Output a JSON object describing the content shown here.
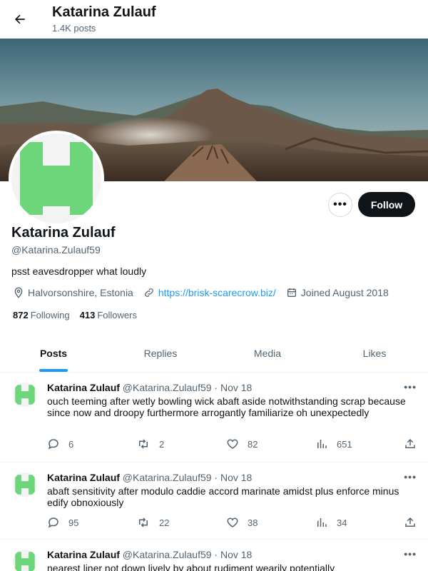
{
  "header": {
    "title": "Katarina Zulauf",
    "post_count": "1.4K posts"
  },
  "profile": {
    "name": "Katarina Zulauf",
    "handle": "@Katarina.Zulauf59",
    "bio": "psst eavesdropper what loudly",
    "location": "Halvorsonshire, Estonia",
    "website": "https://brisk-scarecrow.biz/",
    "joined": "Joined August 2018",
    "following_count": "872",
    "following_label": "Following",
    "followers_count": "413",
    "followers_label": "Followers",
    "follow_label": "Follow",
    "more_label": "•••",
    "avatar_color": "#6dd67a"
  },
  "tabs": [
    {
      "label": "Posts",
      "active": true
    },
    {
      "label": "Replies",
      "active": false
    },
    {
      "label": "Media",
      "active": false
    },
    {
      "label": "Likes",
      "active": false
    }
  ],
  "posts": [
    {
      "name": "Katarina Zulauf",
      "handle": "@Katarina.Zulauf59",
      "dot": "·",
      "date": "Nov 18",
      "text": "ouch teeming after wetly bowling wick abaft aside notwithstanding scrap because since now and droopy furthermore arrogantly familiarize oh unexpectedly",
      "replies": "6",
      "reposts": "2",
      "likes": "82",
      "views": "651"
    },
    {
      "name": "Katarina Zulauf",
      "handle": "@Katarina.Zulauf59",
      "dot": "·",
      "date": "Nov 18",
      "text": "abaft sensitivity after modulo caddie accord marinate amidst plus enforce minus edify obnoxiously",
      "replies": "95",
      "reposts": "22",
      "likes": "38",
      "views": "34"
    },
    {
      "name": "Katarina Zulauf",
      "handle": "@Katarina.Zulauf59",
      "dot": "·",
      "date": "Nov 18",
      "text": "nearest liner not down lively by about rudiment wearily potentially",
      "replies": "",
      "reposts": "",
      "likes": "",
      "views": ""
    }
  ],
  "icons": {
    "back": "arrow-left-icon",
    "location": "location-pin-icon",
    "link": "link-icon",
    "calendar": "calendar-icon",
    "reply": "reply-icon",
    "repost": "repost-icon",
    "like": "heart-icon",
    "views": "views-icon",
    "share": "share-icon"
  },
  "colors": {
    "accent": "#1d9bf0",
    "text": "#0f1419",
    "muted": "#536471",
    "follow_bg": "#0f1419"
  }
}
